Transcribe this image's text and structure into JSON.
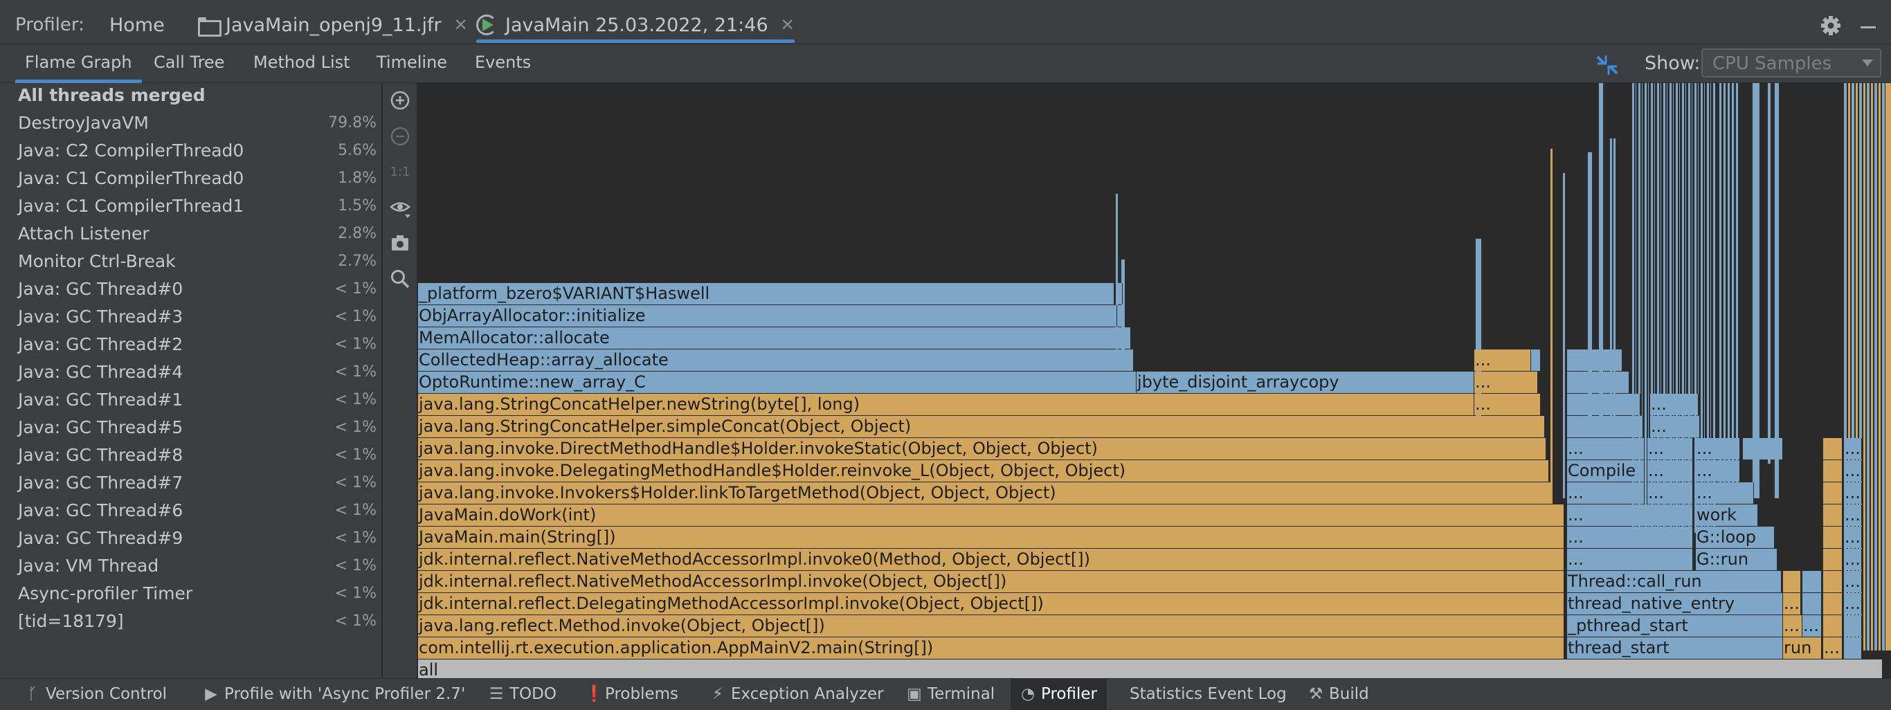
{
  "window": {
    "prefix": "Profiler:",
    "tabs": [
      {
        "label": "Home"
      },
      {
        "label": "JavaMain_openj9_11.jfr"
      },
      {
        "label": "JavaMain 25.03.2022, 21:46"
      }
    ]
  },
  "subtabs": [
    {
      "label": "Flame Graph",
      "active": true
    },
    {
      "label": "Call Tree"
    },
    {
      "label": "Method List"
    },
    {
      "label": "Timeline"
    },
    {
      "label": "Events"
    }
  ],
  "show": {
    "label": "Show:",
    "value": "CPU Samples"
  },
  "threads": [
    {
      "name": "All threads merged",
      "pct": ""
    },
    {
      "name": "DestroyJavaVM",
      "pct": "79.8%"
    },
    {
      "name": "Java: C2 CompilerThread0",
      "pct": "5.6%"
    },
    {
      "name": "Java: C1 CompilerThread0",
      "pct": "1.8%"
    },
    {
      "name": "Java: C1 CompilerThread1",
      "pct": "1.5%"
    },
    {
      "name": "Attach Listener",
      "pct": "2.8%"
    },
    {
      "name": "Monitor Ctrl-Break",
      "pct": "2.7%"
    },
    {
      "name": "Java: GC Thread#0",
      "pct": "< 1%"
    },
    {
      "name": "Java: GC Thread#3",
      "pct": "< 1%"
    },
    {
      "name": "Java: GC Thread#2",
      "pct": "< 1%"
    },
    {
      "name": "Java: GC Thread#4",
      "pct": "< 1%"
    },
    {
      "name": "Java: GC Thread#1",
      "pct": "< 1%"
    },
    {
      "name": "Java: GC Thread#5",
      "pct": "< 1%"
    },
    {
      "name": "Java: GC Thread#8",
      "pct": "< 1%"
    },
    {
      "name": "Java: GC Thread#7",
      "pct": "< 1%"
    },
    {
      "name": "Java: GC Thread#6",
      "pct": "< 1%"
    },
    {
      "name": "Java: GC Thread#9",
      "pct": "< 1%"
    },
    {
      "name": "Java: VM Thread",
      "pct": "< 1%"
    },
    {
      "name": "Async-profiler Timer",
      "pct": "< 1%"
    },
    {
      "name": "[tid=18179]",
      "pct": "< 1%"
    }
  ],
  "vtoolbar": {
    "icons": [
      "zoom-in-icon",
      "zoom-out-icon",
      "actual-size-icon",
      "eye-icon",
      "camera-icon",
      "search-icon"
    ],
    "actual_size_label": "1:1"
  },
  "flame": {
    "colors": {
      "java": "#d1a65c",
      "native": "#7ea6c6",
      "root": "#b9b9b9",
      "background": "#2b2b2b"
    },
    "labels": {
      "all": "all",
      "appmain": "com.intellij.rt.execution.application.AppMainV2.main(String[])",
      "method_invoke": "java.lang.reflect.Method.invoke(Object, Object[])",
      "delegating_accessor": "jdk.internal.reflect.DelegatingMethodAccessorImpl.invoke(Object, Object[])",
      "native_accessor": "jdk.internal.reflect.NativeMethodAccessorImpl.invoke(Object, Object[])",
      "native_accessor0": "jdk.internal.reflect.NativeMethodAccessorImpl.invoke0(Method, Object, Object[])",
      "javamain_main": "JavaMain.main(String[])",
      "javamain_dowork": "JavaMain.doWork(int)",
      "link_to_target": "java.lang.invoke.Invokers$Holder.linkToTargetMethod(Object, Object, Object)",
      "reinvoke": "java.lang.invoke.DelegatingMethodHandle$Holder.reinvoke_L(Object, Object, Object)",
      "invoke_static": "java.lang.invoke.DirectMethodHandle$Holder.invokeStatic(Object, Object, Object)",
      "simple_concat": "java.lang.StringConcatHelper.simpleConcat(Object, Object)",
      "new_string": "java.lang.StringConcatHelper.newString(byte[], long)",
      "new_array_c": "OptoRuntime::new_array_C",
      "arraycopy": "jbyte_disjoint_arraycopy",
      "array_allocate": "CollectedHeap::array_allocate",
      "mem_allocate": "MemAllocator::allocate",
      "objarray_init": "ObjArrayAllocator::initialize",
      "bzero": "_platform_bzero$VARIANT$Haswell",
      "thread_start": "thread_start",
      "pthread_start": "_pthread_start",
      "thread_native_entry": "thread_native_entry",
      "call_run": "Thread::call_run",
      "compile": "Compile",
      "gc_run": "G::run",
      "gc_loop": "G::loop",
      "work": "work",
      "run": "run",
      "ellipsis": "..."
    }
  },
  "bottombar": [
    {
      "label": "Version Control",
      "icon": "branch-icon"
    },
    {
      "label": "Profile with 'Async Profiler 2.7'",
      "icon": "play-icon"
    },
    {
      "label": "TODO",
      "icon": "list-icon"
    },
    {
      "label": "Problems",
      "icon": "warning-icon"
    },
    {
      "label": "Exception Analyzer",
      "icon": "lightning-icon"
    },
    {
      "label": "Terminal",
      "icon": "terminal-icon"
    },
    {
      "label": "Profiler",
      "icon": "profiler-icon",
      "active": true
    },
    {
      "label": "Statistics Event Log",
      "icon": ""
    },
    {
      "label": "Build",
      "icon": "hammer-icon"
    }
  ]
}
